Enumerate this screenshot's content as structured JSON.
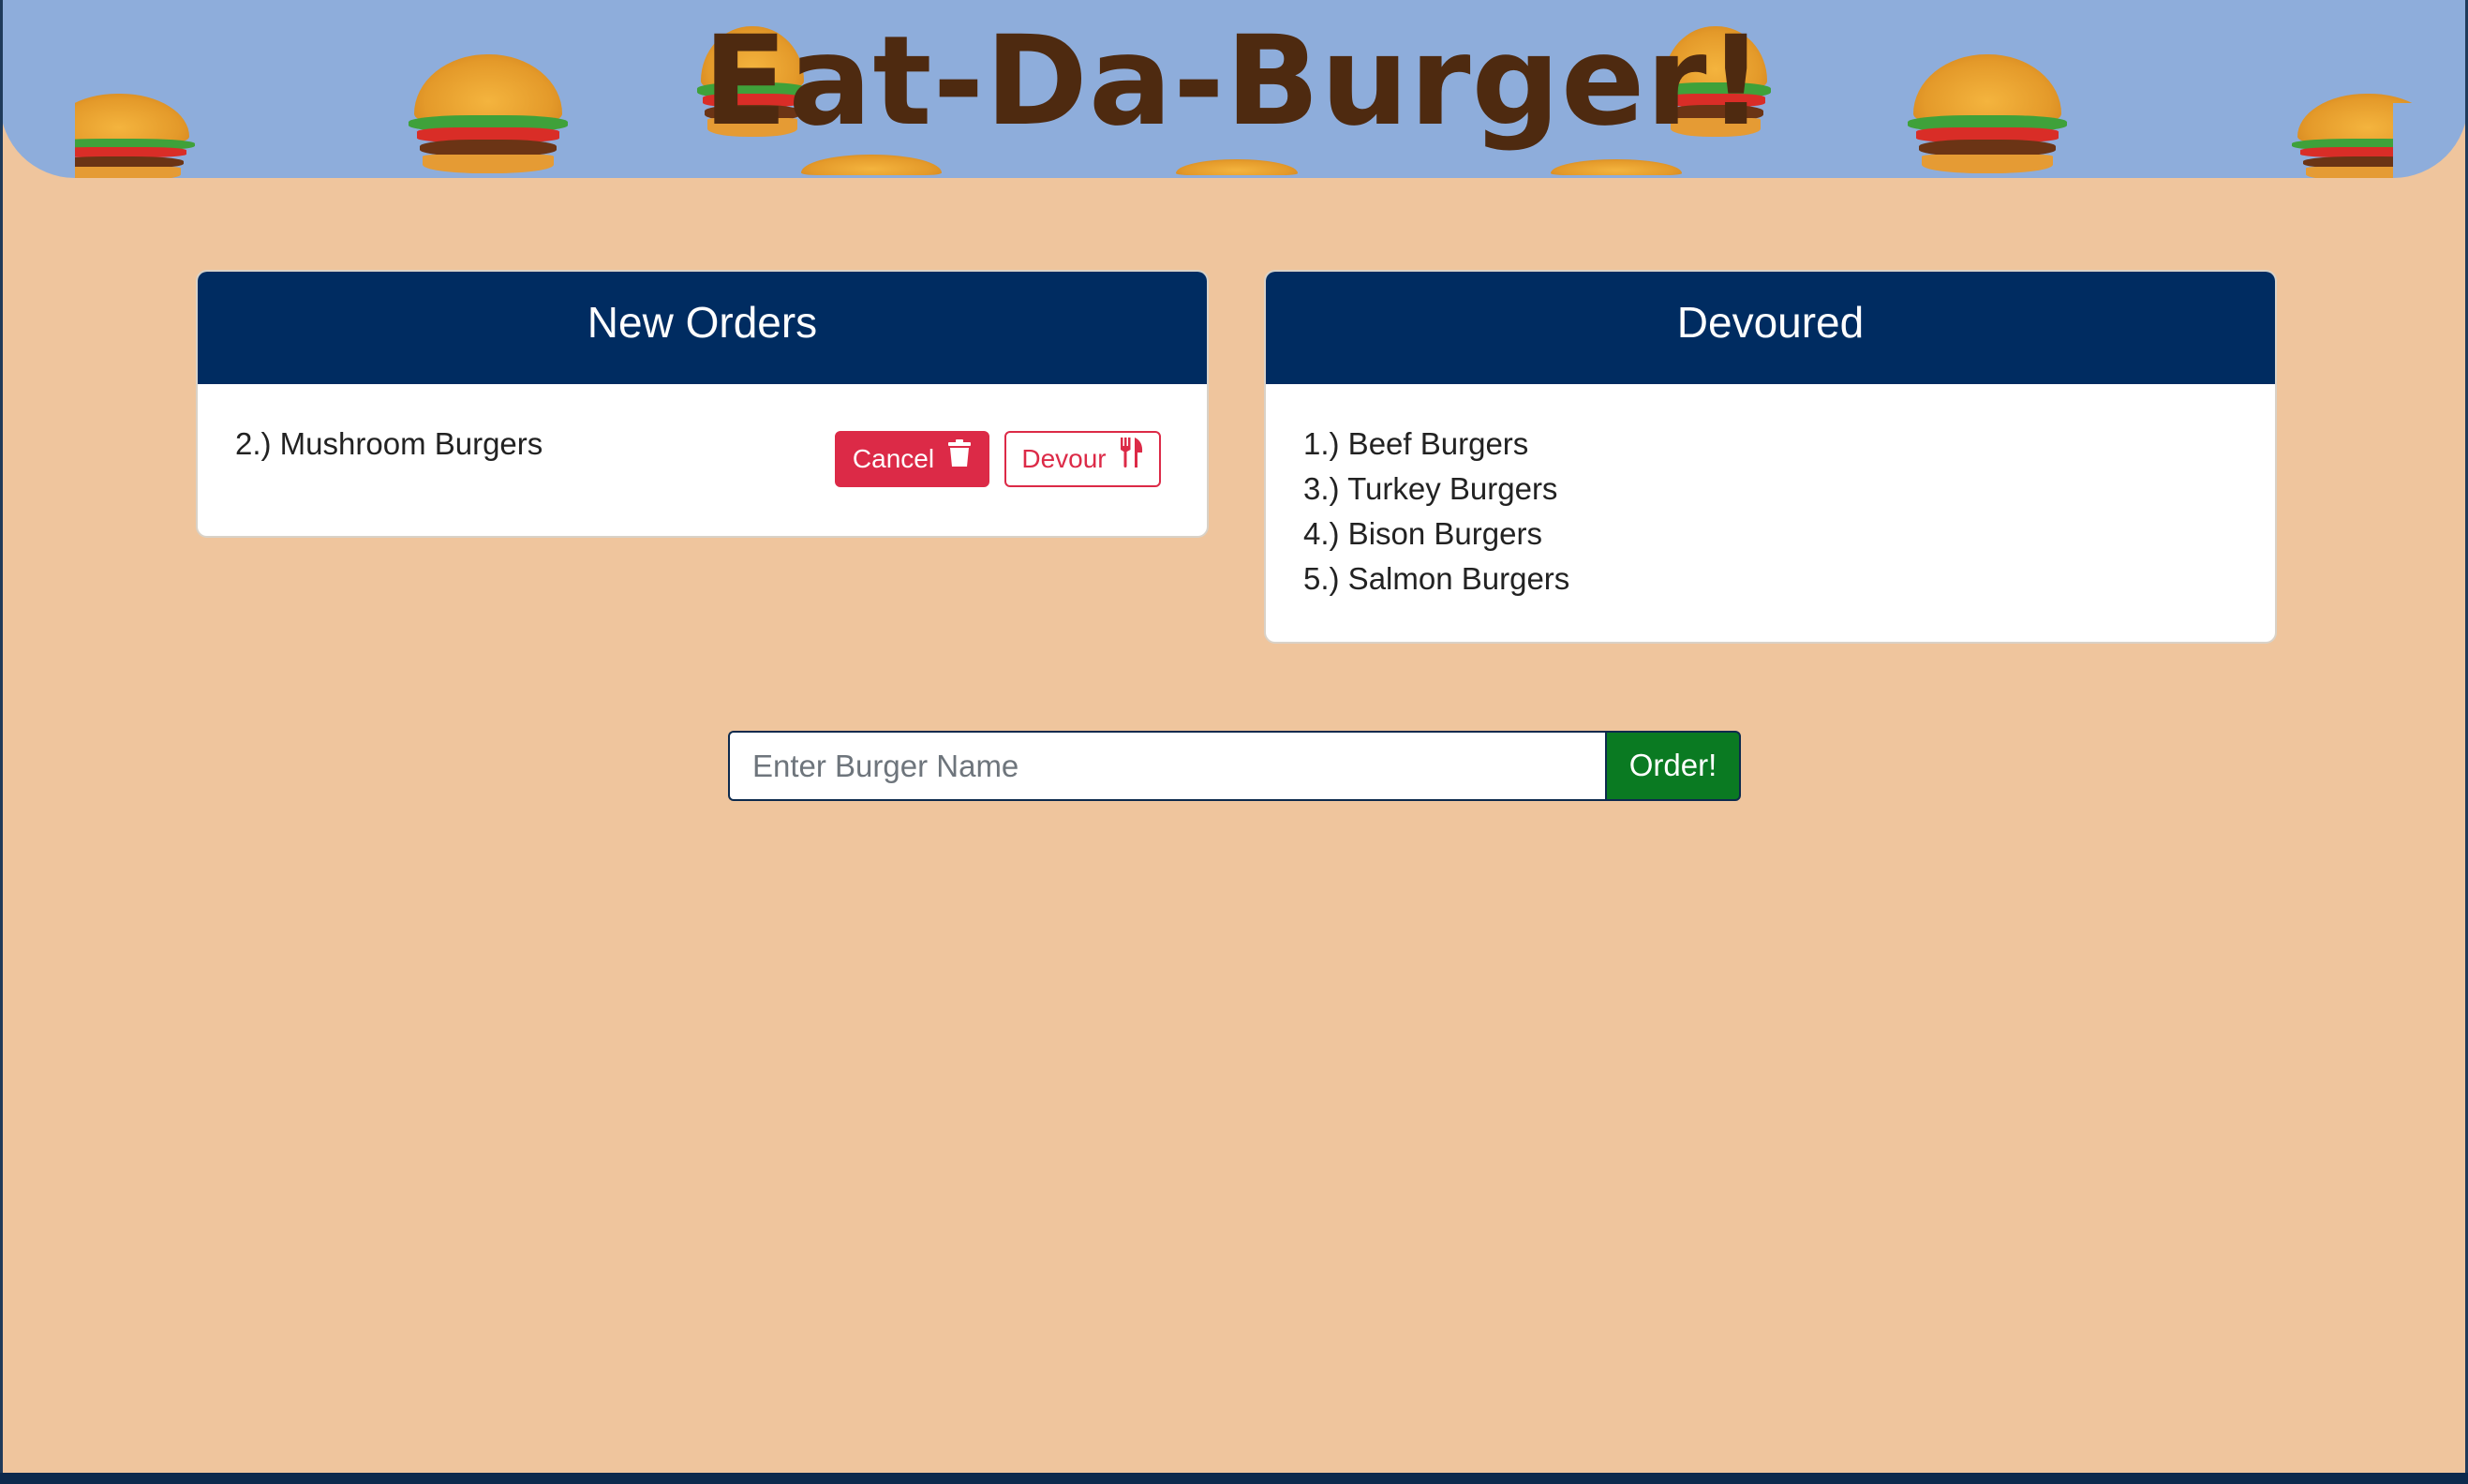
{
  "header": {
    "title": "Eat-Da-Burger!"
  },
  "new_orders": {
    "title": "New Orders",
    "items": [
      {
        "label": "2.) Mushroom Burgers",
        "cancel_label": "Cancel",
        "devour_label": "Devour"
      }
    ]
  },
  "devoured": {
    "title": "Devoured",
    "items": [
      {
        "label": "1.) Beef Burgers"
      },
      {
        "label": "3.) Turkey Burgers"
      },
      {
        "label": "4.) Bison Burgers"
      },
      {
        "label": "5.) Salmon Burgers"
      }
    ]
  },
  "order_form": {
    "input_placeholder": "Enter Burger Name",
    "input_value": "",
    "submit_label": "Order!"
  },
  "colors": {
    "page_bg": "#efc59d",
    "header_bg": "#8eaddb",
    "title_color": "#4e2a10",
    "card_header_bg": "#002c61",
    "danger": "#dc2a47",
    "order_button": "#0a7a22"
  },
  "icons": {
    "cancel": "trash-icon",
    "devour": "utensils-icon",
    "decor": "burger-icon"
  }
}
